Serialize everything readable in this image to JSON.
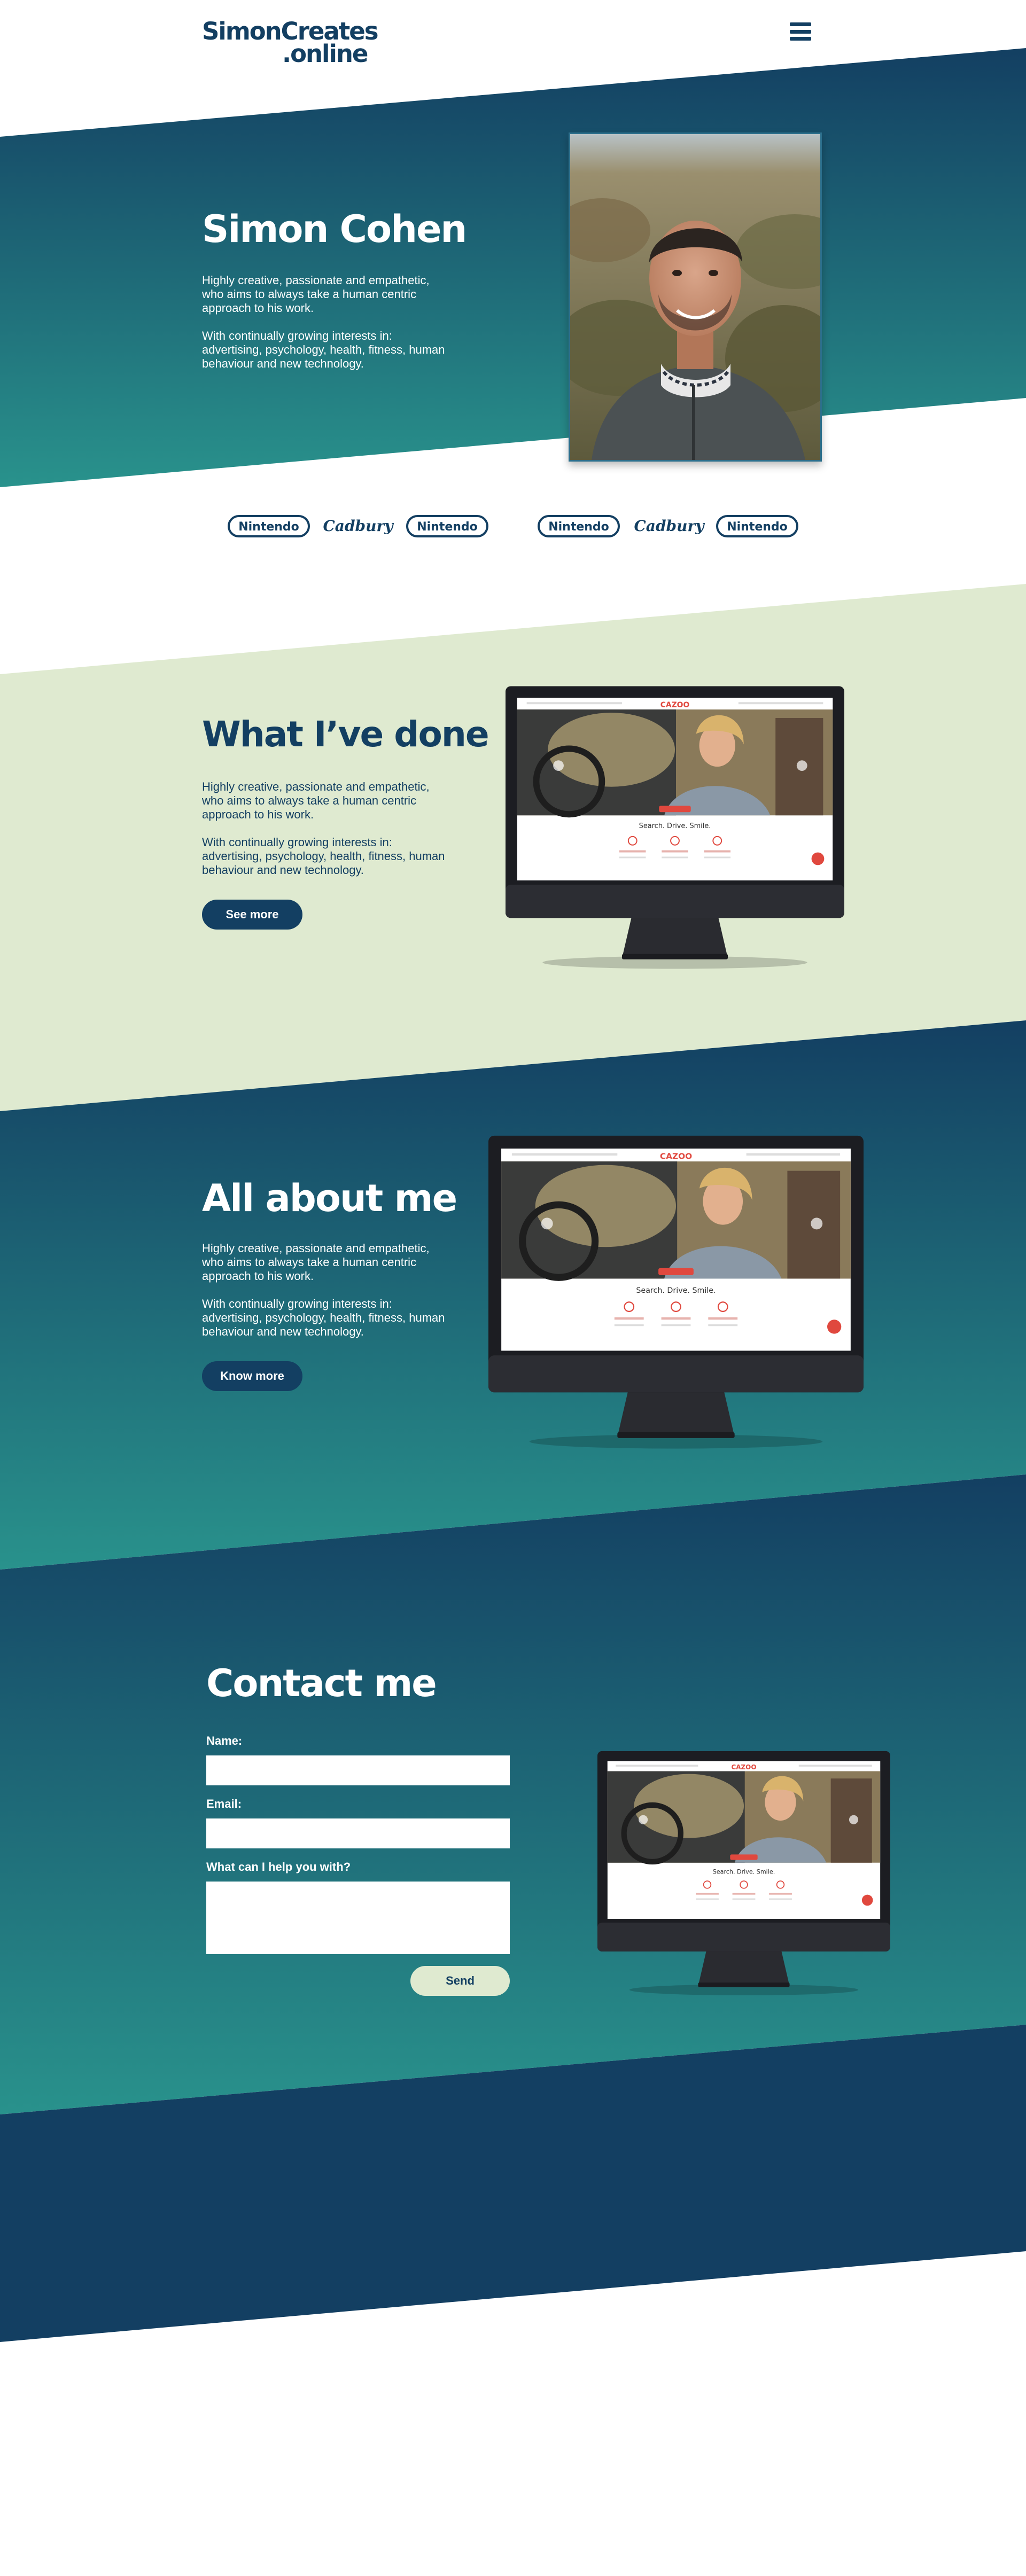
{
  "brand": {
    "line1": "SimonCreates",
    "line2": ".online"
  },
  "colors": {
    "navy": "#133f62",
    "teal": "#29928c",
    "pale_green": "#dfead0"
  },
  "icons": {
    "menu": "hamburger-menu-icon"
  },
  "hero": {
    "title": "Simon Cohen",
    "p1": "Highly creative, passionate and empathetic, who aims to always take a human centric approach to his work.",
    "p2": "With continually growing interests in: advertising, psychology, health, fitness, human behaviour and new technology."
  },
  "clients": [
    "Nintendo",
    "Cadbury",
    "Nintendo",
    "Nintendo",
    "Cadbury",
    "Nintendo"
  ],
  "done": {
    "title": "What I’ve done",
    "p1": "Highly creative, passionate and empathetic, who aims to always take a human centric approach to his work.",
    "p2": "With continually growing interests in: advertising, psychology, health, fitness, human behaviour and new technology.",
    "button": "See more"
  },
  "about": {
    "title": "All about me",
    "p1": "Highly creative, passionate and empathetic, who aims to always take a human centric approach to his work.",
    "p2": "With continually growing interests in: advertising, psychology, health, fitness, human behaviour and new technology.",
    "button": "Know more"
  },
  "mockup": {
    "brand": "CAZOO",
    "tagline": "Search. Drive. Smile."
  },
  "contact": {
    "title": "Contact me",
    "name_label": "Name:",
    "email_label": "Email:",
    "help_label": "What can I help you with?",
    "send": "Send"
  }
}
